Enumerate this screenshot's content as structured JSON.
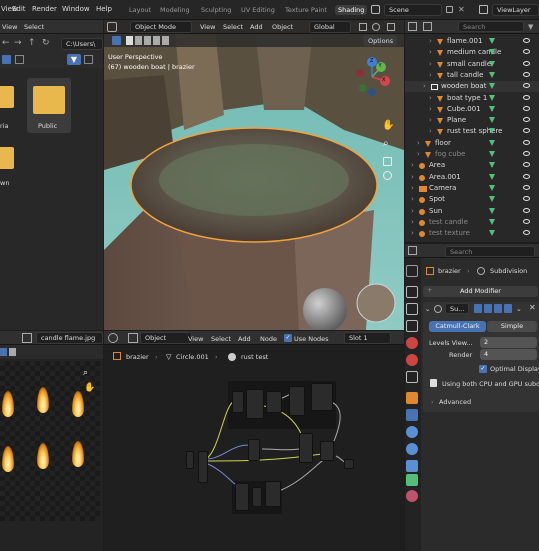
{
  "menubar": {
    "items": [
      "View",
      "Edit",
      "Render",
      "Window",
      "Help"
    ],
    "workspaces": [
      "Layout",
      "Modeling",
      "Sculpting",
      "UV Editing",
      "Texture Paint",
      "Shading"
    ],
    "active_workspace": "Shading",
    "scene": "Scene",
    "view_layer": "ViewLayer"
  },
  "file_browser": {
    "menu": [
      "View",
      "Select"
    ],
    "path": "C:\\Users\\",
    "items": [
      {
        "label": "ria"
      },
      {
        "label": "Public"
      },
      {
        "label": "wn"
      }
    ]
  },
  "viewport": {
    "mode": "Object Mode",
    "menus": [
      "View",
      "Select",
      "Add",
      "Object"
    ],
    "orientation": "Global",
    "options": "Options",
    "overlay_line1": "User Perspective",
    "overlay_line2": "(67) wooden boat | brazier",
    "axes": {
      "x": "X",
      "y": "Y",
      "z": "Z"
    }
  },
  "outliner": {
    "search_placeholder": "Search",
    "rows": [
      {
        "label": "flame.001",
        "type": "cone"
      },
      {
        "label": "medium candle",
        "type": "cone"
      },
      {
        "label": "small candle",
        "type": "cone"
      },
      {
        "label": "tall candle",
        "type": "cone"
      },
      {
        "label": "wooden boat",
        "type": "collection"
      },
      {
        "label": "boat type 1",
        "type": "cone"
      },
      {
        "label": "Cube.001",
        "type": "cone"
      },
      {
        "label": "Plane",
        "type": "cone"
      },
      {
        "label": "rust test sphere",
        "type": "cone"
      },
      {
        "label": "floor",
        "type": "cone"
      },
      {
        "label": "fog cube",
        "type": "cone"
      },
      {
        "label": "Area",
        "type": "light"
      },
      {
        "label": "Area.001",
        "type": "light"
      },
      {
        "label": "Camera",
        "type": "camera"
      },
      {
        "label": "Spot",
        "type": "light"
      },
      {
        "label": "Sun",
        "type": "light"
      },
      {
        "label": "test candle",
        "type": "light"
      },
      {
        "label": "test texture",
        "type": "light"
      }
    ]
  },
  "properties": {
    "search_placeholder": "Search",
    "object": "brazier",
    "modifier_name_short": "Subdivision",
    "add_modifier": "Add Modifier",
    "modifier_label": "Su...",
    "tab_catmull": "Catmull-Clark",
    "tab_simple": "Simple",
    "levels_viewport_label": "Levels View...",
    "levels_viewport": "2",
    "render_label": "Render",
    "render_value": "4",
    "optimal_display": "Optimal Display",
    "info": "Using both CPU and GPU subdi",
    "advanced": "Advanced"
  },
  "image_editor": {
    "image_name": "candle flame.jpg"
  },
  "node_editor": {
    "object_menu": "Object",
    "menus": [
      "View",
      "Select",
      "Add",
      "Node"
    ],
    "use_nodes": "Use Nodes",
    "slot": "Slot 1",
    "breadcrumb": [
      "brazier",
      "Circle.001",
      "rust test"
    ]
  },
  "colors": {
    "accent": "#4772b3",
    "outline_orange": "#f0a23b",
    "cone_orange": "#e0882f",
    "green_icon": "#53c07a"
  }
}
